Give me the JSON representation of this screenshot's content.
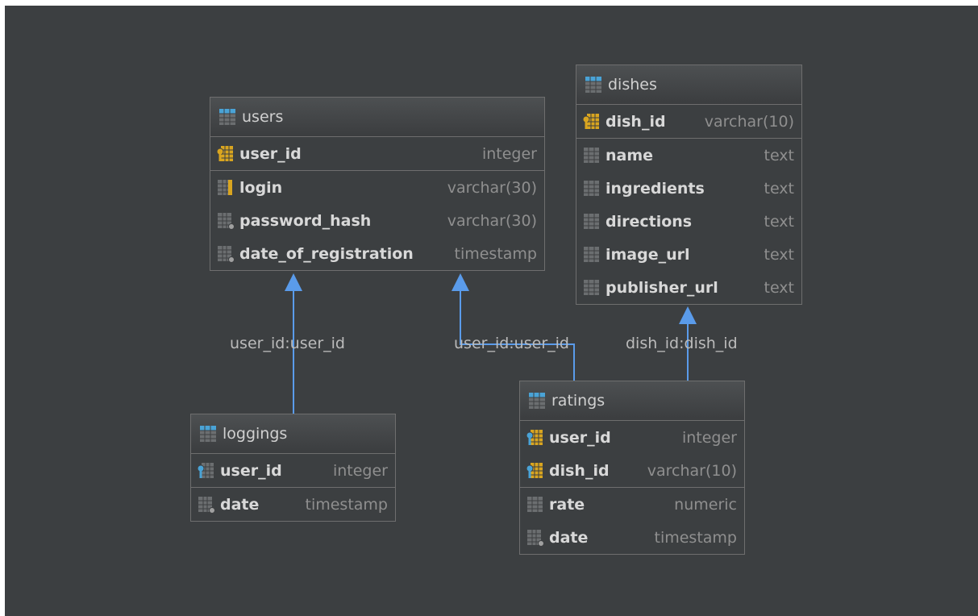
{
  "colors": {
    "canvas": "#3c3f41",
    "link": "#5a9bea",
    "table_icon_header": "#4aa3d6",
    "key_gold": "#d9a520",
    "key_blue": "#4aa3d6"
  },
  "tables": {
    "users": {
      "name": "users",
      "pk": [
        {
          "name": "user_id",
          "type": "integer",
          "icon": "primary-key-icon"
        }
      ],
      "columns": [
        {
          "name": "login",
          "type": "varchar(30)",
          "icon": "unique-column-icon"
        },
        {
          "name": "password_hash",
          "type": "varchar(30)",
          "icon": "not-null-column-icon"
        },
        {
          "name": "date_of_registration",
          "type": "timestamp",
          "icon": "not-null-column-icon"
        }
      ]
    },
    "dishes": {
      "name": "dishes",
      "pk": [
        {
          "name": "dish_id",
          "type": "varchar(10)",
          "icon": "primary-key-icon"
        }
      ],
      "columns": [
        {
          "name": "name",
          "type": "text",
          "icon": "column-icon"
        },
        {
          "name": "ingredients",
          "type": "text",
          "icon": "column-icon"
        },
        {
          "name": "directions",
          "type": "text",
          "icon": "column-icon"
        },
        {
          "name": "image_url",
          "type": "text",
          "icon": "column-icon"
        },
        {
          "name": "publisher_url",
          "type": "text",
          "icon": "column-icon"
        }
      ]
    },
    "loggings": {
      "name": "loggings",
      "pk": [
        {
          "name": "user_id",
          "type": "integer",
          "icon": "foreign-key-icon"
        }
      ],
      "columns": [
        {
          "name": "date",
          "type": "timestamp",
          "icon": "not-null-column-icon"
        }
      ]
    },
    "ratings": {
      "name": "ratings",
      "pk": [
        {
          "name": "user_id",
          "type": "integer",
          "icon": "primary-foreign-key-icon"
        },
        {
          "name": "dish_id",
          "type": "varchar(10)",
          "icon": "primary-foreign-key-icon"
        }
      ],
      "columns": [
        {
          "name": "rate",
          "type": "numeric",
          "icon": "column-icon"
        },
        {
          "name": "date",
          "type": "timestamp",
          "icon": "not-null-column-icon"
        }
      ]
    }
  },
  "links": [
    {
      "label": "user_id:user_id",
      "from": "loggings",
      "to": "users"
    },
    {
      "label": "user_id:user_id",
      "from": "ratings",
      "to": "users"
    },
    {
      "label": "dish_id:dish_id",
      "from": "ratings",
      "to": "dishes"
    }
  ]
}
